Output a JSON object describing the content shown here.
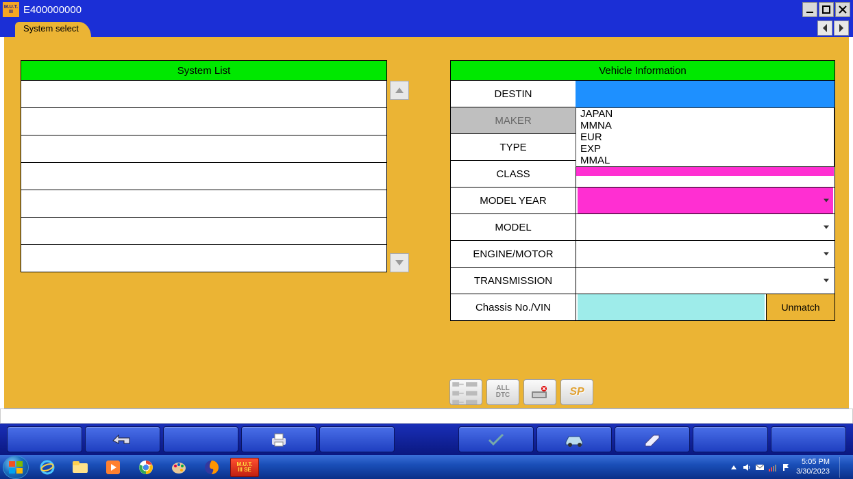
{
  "window": {
    "title": "E400000000"
  },
  "tab": {
    "label": "System select"
  },
  "system_list": {
    "header": "System List",
    "rows": 7
  },
  "vehicle_info": {
    "header": "Vehicle Information",
    "labels": {
      "destin": "DESTIN",
      "maker": "MAKER",
      "type": "TYPE",
      "class": "CLASS",
      "model_year": "MODEL YEAR",
      "model": "MODEL",
      "engine": "ENGINE/MOTOR",
      "transmission": "TRANSMISSION",
      "chassis": "Chassis No./VIN"
    },
    "unmatch_label": "Unmatch",
    "destin_options": [
      "JAPAN",
      "MMNA",
      "EUR",
      "EXP",
      "MMAL"
    ]
  },
  "toolbar": {
    "all_dtc": "ALL\nDTC",
    "sp": "SP"
  },
  "tray": {
    "time": "5:05 PM",
    "date": "3/30/2023"
  }
}
